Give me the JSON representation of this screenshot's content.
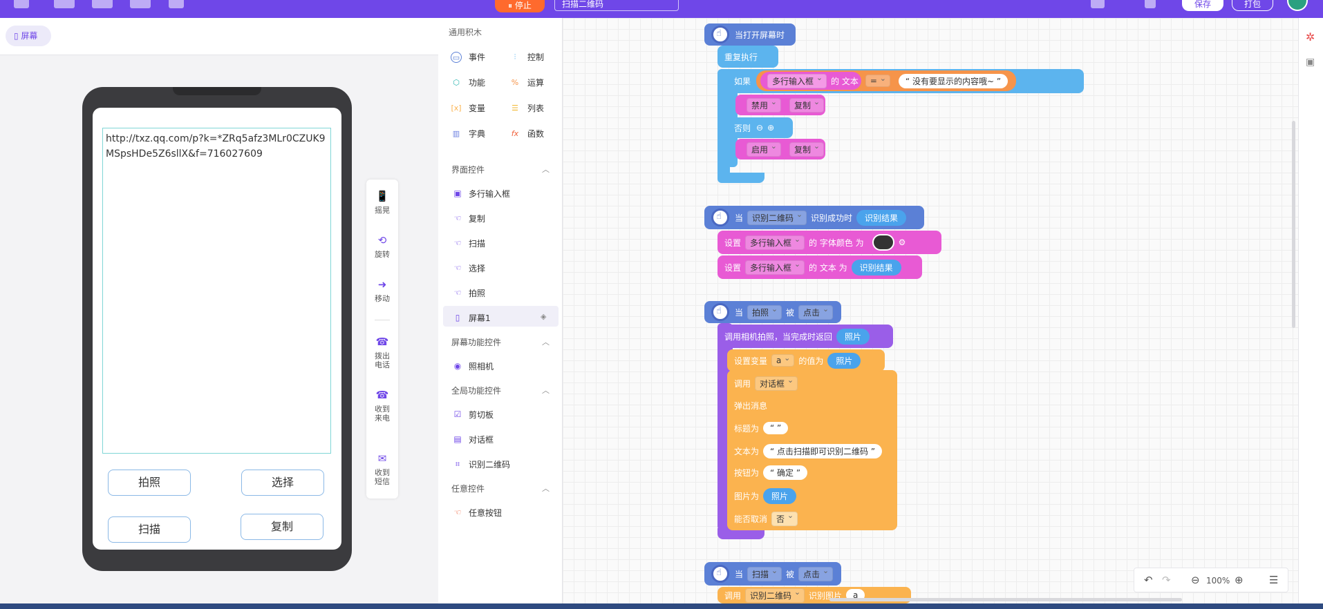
{
  "topbar": {
    "stop_label": "⏸ 停止",
    "project_name": "扫描二维码",
    "save_label": "保存",
    "pack_label": "打包"
  },
  "left": {
    "screen_tab": "屏幕",
    "textarea_value": "http://txz.qq.com/p?k=*ZRq5afz3MLr0CZUK9MSpsHDe5Z6sllX&f=716027609",
    "buttons": [
      "拍照",
      "选择",
      "扫描",
      "复制"
    ]
  },
  "sensors": [
    {
      "icon": "shake-icon",
      "label": "摇晃"
    },
    {
      "icon": "rotate-icon",
      "label": "旋转"
    },
    {
      "icon": "move-icon",
      "label": "移动"
    },
    {
      "icon": "call-out-icon",
      "label": "拨出电话"
    },
    {
      "icon": "call-in-icon",
      "label": "收到来电"
    },
    {
      "icon": "sms-icon",
      "label": "收到短信"
    }
  ],
  "palette": {
    "title": "通用积木",
    "categories": [
      {
        "label": "事件",
        "color": "#5b80d6"
      },
      {
        "label": "控制",
        "color": "#5cb4ee"
      },
      {
        "label": "功能",
        "color": "#2bb5b0"
      },
      {
        "label": "运算",
        "color": "#f6944a"
      },
      {
        "label": "变量",
        "color": "#fbb34f"
      },
      {
        "label": "列表",
        "color": "#f2b72f"
      },
      {
        "label": "字典",
        "color": "#6a7fe0"
      },
      {
        "label": "函数",
        "color": "#f0623c"
      }
    ],
    "sections": [
      {
        "title": "界面控件",
        "items": [
          "多行输入框",
          "复制",
          "扫描",
          "选择",
          "拍照",
          "屏幕1"
        ]
      },
      {
        "title": "屏幕功能控件",
        "items": [
          "照相机"
        ]
      },
      {
        "title": "全局功能控件",
        "items": [
          "剪切板",
          "对话框",
          "识别二维码"
        ]
      },
      {
        "title": "任意控件",
        "items": [
          "任意按钮"
        ]
      }
    ]
  },
  "blocks": {
    "b1": {
      "hat": "当打开屏幕时",
      "repeat": "重复执行",
      "if": "如果",
      "if_component": "多行输入框",
      "of_text": "的 文本",
      "op": "=",
      "compare_str": "“ 没有要显示的内容哦~ ”",
      "disable": "禁用",
      "copy": "复制",
      "else": "否则",
      "enable": "启用"
    },
    "b2": {
      "when": "当",
      "component": "识别二维码",
      "event": "识别成功时",
      "result": "识别结果",
      "set": "设置",
      "target": "多行输入框",
      "font_color": "的 字体颜色 为",
      "text_to": "的 文本 为"
    },
    "b3": {
      "when": "当",
      "component": "拍照",
      "by": "被",
      "click": "点击",
      "camera": "调用相机拍照，当完成时返回",
      "photo": "照片",
      "set_var": "设置变量",
      "var_name": "a",
      "value_of": "的值为",
      "call": "调用",
      "dialog": "对话框",
      "popup": "弹出消息",
      "title_is": "标题为",
      "title_val": "“ ”",
      "text_is": "文本为",
      "text_val": "“ 点击扫描即可识别二维码 ”",
      "btn_is": "按钮为",
      "btn_val": "“ 确定 ”",
      "img_is": "图片为",
      "cancel_is": "能否取消",
      "cancel_val": "否"
    },
    "b4": {
      "when": "当",
      "component": "扫描",
      "by": "被",
      "click": "点击",
      "call": "调用",
      "qr": "识别二维码",
      "recognize": "识别图片",
      "var": "a"
    }
  },
  "zoom": "100%"
}
